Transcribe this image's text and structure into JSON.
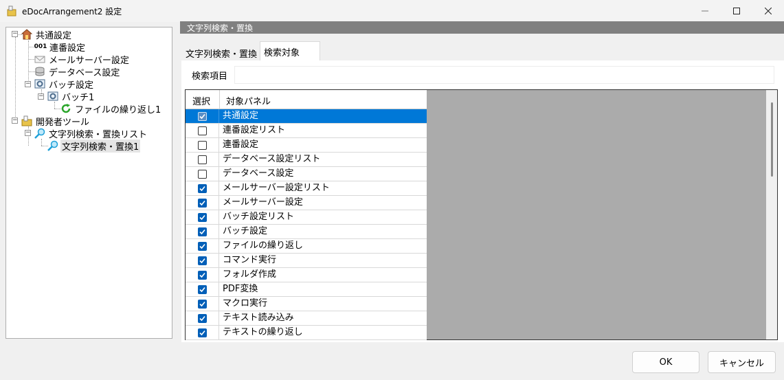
{
  "window": {
    "title": "eDocArrangement2 設定",
    "icon": "folder-icon"
  },
  "tree": {
    "items": [
      {
        "label": "共通設定",
        "icon": "house-icon"
      },
      {
        "label": "連番設定",
        "icon": "number-001-icon",
        "icon_text": "001"
      },
      {
        "label": "メールサーバー設定",
        "icon": "envelope-icon"
      },
      {
        "label": "データベース設定",
        "icon": "database-icon"
      },
      {
        "label": "バッチ設定",
        "icon": "gear-box-icon"
      },
      {
        "label": "バッチ1",
        "icon": "gear-box-icon"
      },
      {
        "label": "ファイルの繰り返し1",
        "icon": "green-loop-icon"
      },
      {
        "label": "開発者ツール",
        "icon": "folder-tools-icon"
      },
      {
        "label": "文字列検索・置換リスト",
        "icon": "magnifier-icon"
      },
      {
        "label": "文字列検索・置換1",
        "icon": "magnifier-icon"
      }
    ]
  },
  "panel": {
    "header": "文字列検索・置換",
    "tabs": [
      {
        "label": "文字列検索・置換",
        "active": false
      },
      {
        "label": "検索対象",
        "active": true
      }
    ],
    "search_label": "検索項目",
    "search_value": "",
    "grid": {
      "col_select": "選択",
      "col_target": "対象パネル",
      "rows": [
        {
          "label": "共通設定",
          "checked": true,
          "selected": true
        },
        {
          "label": "連番設定リスト",
          "checked": false
        },
        {
          "label": "連番設定",
          "checked": false
        },
        {
          "label": "データベース設定リスト",
          "checked": false
        },
        {
          "label": "データベース設定",
          "checked": false
        },
        {
          "label": "メールサーバー設定リスト",
          "checked": true
        },
        {
          "label": "メールサーバー設定",
          "checked": true
        },
        {
          "label": "バッチ設定リスト",
          "checked": true
        },
        {
          "label": "バッチ設定",
          "checked": true
        },
        {
          "label": "ファイルの繰り返し",
          "checked": true
        },
        {
          "label": "コマンド実行",
          "checked": true
        },
        {
          "label": "フォルダ作成",
          "checked": true
        },
        {
          "label": "PDF変換",
          "checked": true
        },
        {
          "label": "マクロ実行",
          "checked": true
        },
        {
          "label": "テキスト読み込み",
          "checked": true
        },
        {
          "label": "テキストの繰り返し",
          "checked": true
        }
      ]
    }
  },
  "buttons": {
    "ok": "OK",
    "cancel": "キャンセル"
  },
  "colors": {
    "selection": "#0078d7",
    "checkbox_checked": "#005fb8",
    "panel_header": "#808080",
    "grid_empty_area": "#ababab"
  }
}
